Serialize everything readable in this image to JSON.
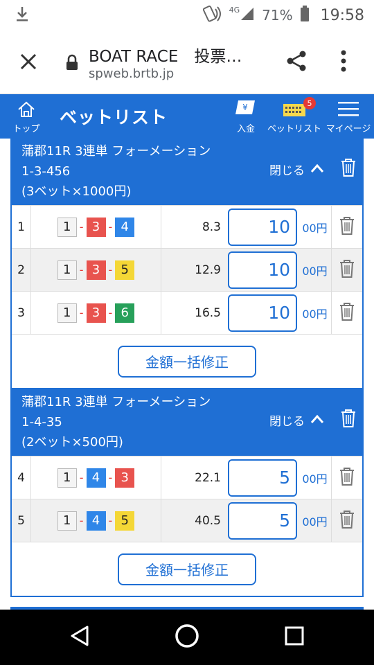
{
  "status_bar": {
    "network": "4G",
    "battery": "71%",
    "time": "19:58"
  },
  "browser": {
    "page_title": "BOAT RACE　投票…",
    "url": "spweb.brtb.jp"
  },
  "header": {
    "home_label": "トップ",
    "title": "ベットリスト",
    "deposit_label": "入金",
    "betlist_label": "ベットリスト",
    "betlist_badge": "5",
    "mypage_label": "マイページ"
  },
  "cards": [
    {
      "line1": "蒲郡11R 3連単 フォーメーション",
      "line2": "1-3-456",
      "line3": "(3ベット×1000円)",
      "close_label": "閉じる",
      "bulk_label": "金額一括修正",
      "bets": [
        {
          "index": "1",
          "combo": [
            "1",
            "3",
            "4"
          ],
          "odds": "8.3",
          "amount": "10",
          "unit": "00円"
        },
        {
          "index": "2",
          "combo": [
            "1",
            "3",
            "5"
          ],
          "odds": "12.9",
          "amount": "10",
          "unit": "00円"
        },
        {
          "index": "3",
          "combo": [
            "1",
            "3",
            "6"
          ],
          "odds": "16.5",
          "amount": "10",
          "unit": "00円"
        }
      ]
    },
    {
      "line1": "蒲郡11R 3連単 フォーメーション",
      "line2": "1-4-35",
      "line3": "(2ベット×500円)",
      "close_label": "閉じる",
      "bulk_label": "金額一括修正",
      "bets": [
        {
          "index": "4",
          "combo": [
            "1",
            "4",
            "3"
          ],
          "odds": "22.1",
          "amount": "5",
          "unit": "00円"
        },
        {
          "index": "5",
          "combo": [
            "1",
            "4",
            "5"
          ],
          "odds": "40.5",
          "amount": "5",
          "unit": "00円"
        }
      ]
    }
  ],
  "boat_colors": {
    "1": "#f4f4f4",
    "3": "#e8534e",
    "4": "#2f86e8",
    "5": "#f4d736",
    "6": "#27a05a"
  }
}
